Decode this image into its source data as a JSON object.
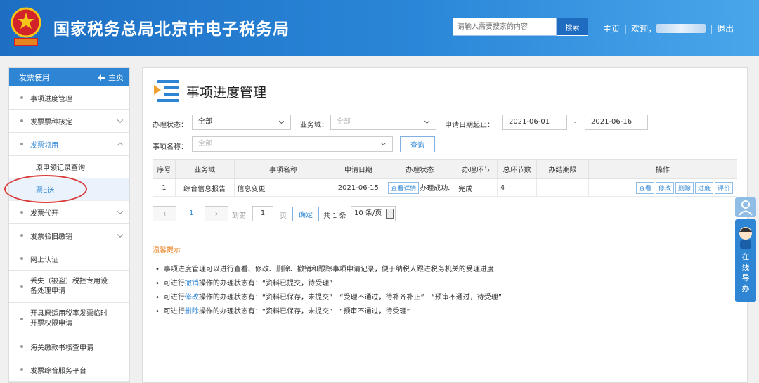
{
  "header": {
    "site_title": "国家税务总局北京市电子税务局",
    "search_placeholder": "请输入需要搜索的内容",
    "search_button": "搜索",
    "home_link": "主页",
    "welcome": "欢迎，",
    "logout": "退出",
    "colors": {
      "bar_start": "#1e6fc4",
      "bar_end": "#4aa6ea"
    }
  },
  "sidebar": {
    "header_label": "发票使用",
    "header_home": "主页",
    "items": [
      {
        "label": "事项进度管理"
      },
      {
        "label": "发票票种核定"
      },
      {
        "label": "发票领用"
      },
      {
        "label": "原申领记录查询"
      },
      {
        "label": "票E送"
      },
      {
        "label": "发票代开"
      },
      {
        "label": "发票验旧缴销"
      },
      {
        "label": "网上认证"
      },
      {
        "label": "丢失（被盗）税控专用设备处理申请"
      },
      {
        "label": "开具原适用税率发票临时开票权限申请"
      },
      {
        "label": "海关缴款书核查申请"
      },
      {
        "label": "发票综合服务平台"
      }
    ]
  },
  "main": {
    "title": "事项进度管理",
    "filters": {
      "status_label": "办理状态：",
      "status_value": "全部",
      "domain_label": "业务域：",
      "domain_value": "全部",
      "date_label": "申请日期起止：",
      "date_from": "2021-06-01",
      "date_dash": "-",
      "date_to": "2021-06-16",
      "name_label": "事项名称：",
      "name_value": "全部",
      "query_button": "查询"
    },
    "table": {
      "headers": [
        "序号",
        "业务域",
        "事项名称",
        "申请日期",
        "办理状态",
        "办理环节",
        "总环节数",
        "办结期限",
        "操作"
      ],
      "rows": [
        {
          "seq": "1",
          "domain": "综合信息报告",
          "name": "信息变更",
          "date": "2021-06-15",
          "status_button": "查看详情",
          "status_text": "办理成功、",
          "step": "完成",
          "total": "4",
          "deadline": ""
        }
      ],
      "ops": [
        "查看",
        "修改",
        "删除",
        "进度",
        "评价"
      ]
    },
    "pager": {
      "prev": "‹",
      "current": "1",
      "next": "›",
      "goto_label": "到第",
      "goto_value": "1",
      "page_unit": "页",
      "confirm": "确定",
      "total": "共 1 条",
      "page_size": "10 条/页"
    },
    "tips": {
      "title": "温馨提示",
      "lines": [
        {
          "pre": "事项进度管理可以进行查看、修改、删除、撤销和跟踪事项申请记录，便于纳税人跟进税务机关的受理进度",
          "hl": "",
          "post": ""
        },
        {
          "pre": "可进行",
          "hl": "撤销",
          "post": "操作的办理状态有：“资料已提交，待受理”"
        },
        {
          "pre": "可进行",
          "hl": "修改",
          "post": "操作的办理状态有：“资料已保存，未提交”　“受理不通过，待补齐补正”　“预审不通过，待受理”"
        },
        {
          "pre": "可进行",
          "hl": "删除",
          "post": "操作的办理状态有：“资料已保存，未提交”　“预审不通过，待受理”"
        }
      ]
    }
  },
  "float": {
    "guide_label": "在线导办"
  }
}
